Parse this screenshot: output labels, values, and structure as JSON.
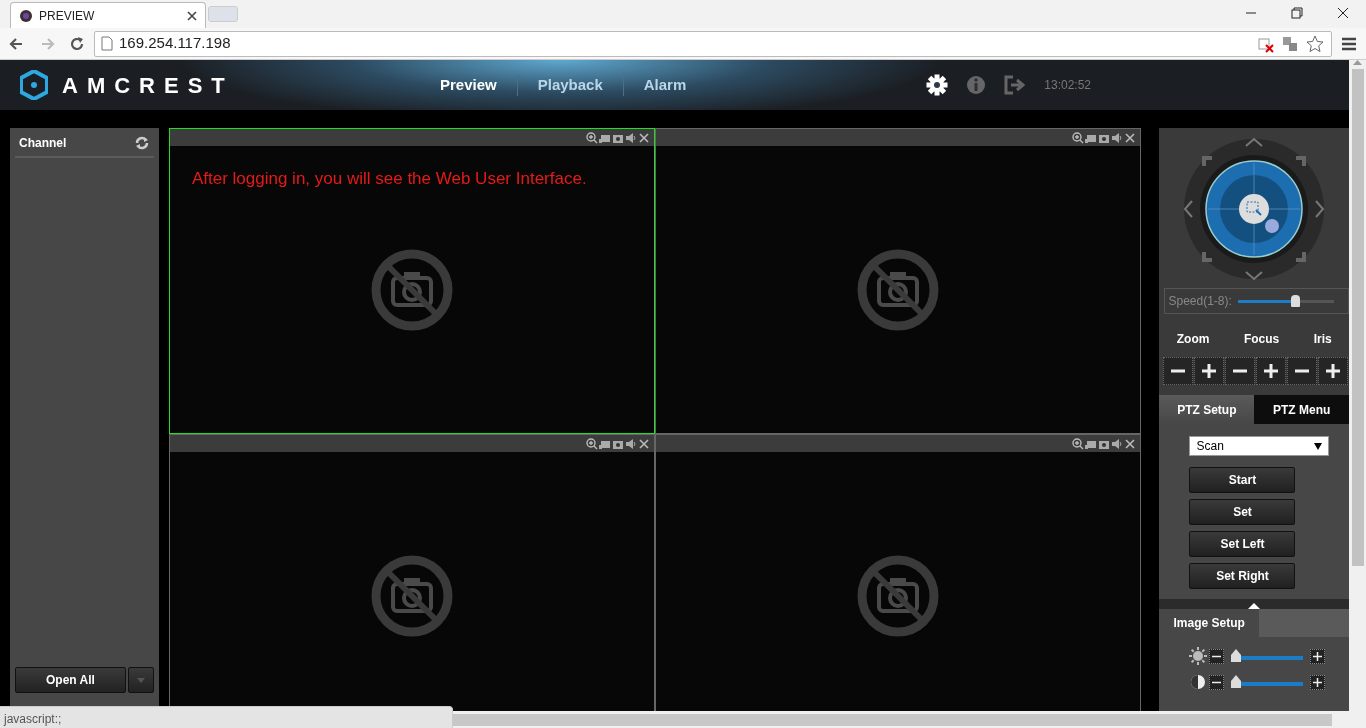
{
  "browser": {
    "tab_title": "PREVIEW",
    "address": "169.254.117.198",
    "status_text": "javascript:;"
  },
  "header": {
    "logo": "AMCREST",
    "time": "13:02:52"
  },
  "nav": [
    {
      "label": "Preview",
      "selected": true
    },
    {
      "label": "Playback",
      "selected": false
    },
    {
      "label": "Alarm",
      "selected": false
    }
  ],
  "channel_panel": {
    "title": "Channel",
    "buttons": [
      "Open All"
    ]
  },
  "video_cells": [
    {
      "selected": true,
      "caption": "After logging in, you will see the Web User Interface."
    },
    {
      "selected": false
    },
    {
      "selected": false
    },
    {
      "selected": false
    }
  ],
  "ptz": {
    "speed": {
      "label": "Speed(1-8):",
      "level": 0.6
    },
    "controls": [
      "Zoom",
      "Focus",
      "Iris"
    ]
  },
  "ptz_tabs": [
    {
      "label": "PTZ Setup",
      "selected": true
    },
    {
      "label": "PTZ Menu",
      "selected": false
    }
  ],
  "ptz_setup": {
    "mode": "Scan",
    "actions": [
      "Start",
      "Set",
      "Set Left",
      "Set Right"
    ]
  },
  "image_setup": {
    "title": "Image Setup",
    "sliders": [
      {
        "kind": "brightness",
        "level": 0.03
      },
      {
        "kind": "contrast",
        "level": 0.03
      }
    ]
  }
}
